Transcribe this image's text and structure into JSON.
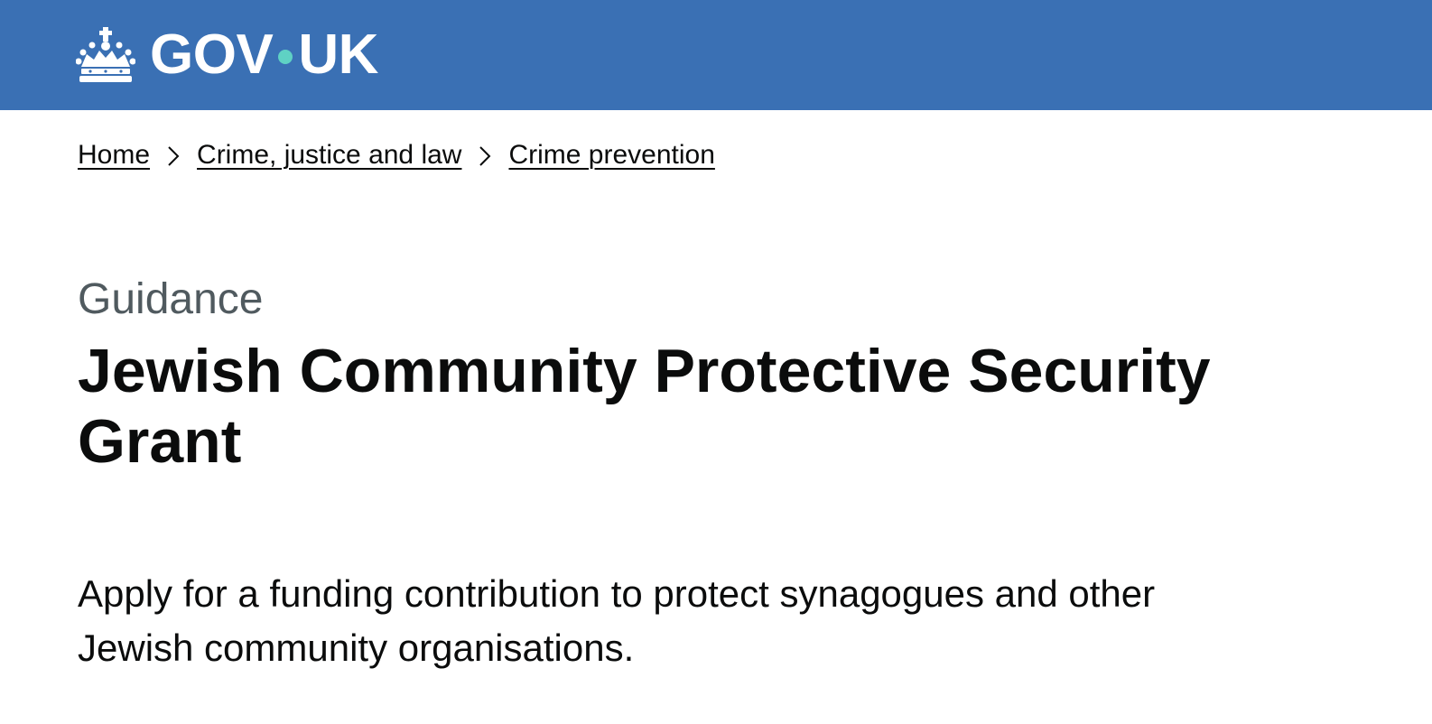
{
  "header": {
    "logo_text_left": "GOV",
    "logo_text_right": "UK",
    "brand_color": "#3a70b4",
    "dot_color": "#5fd1c4",
    "crown_icon": "crown-icon"
  },
  "breadcrumbs": {
    "items": [
      {
        "label": "Home"
      },
      {
        "label": "Crime, justice and law"
      },
      {
        "label": "Crime prevention"
      }
    ],
    "separator_icon": "chevron-right-icon"
  },
  "page": {
    "caption": "Guidance",
    "title": "Jewish Community Protective Security Grant",
    "lead": "Apply for a funding contribution to protect synagogues and other Jewish community organisations."
  }
}
